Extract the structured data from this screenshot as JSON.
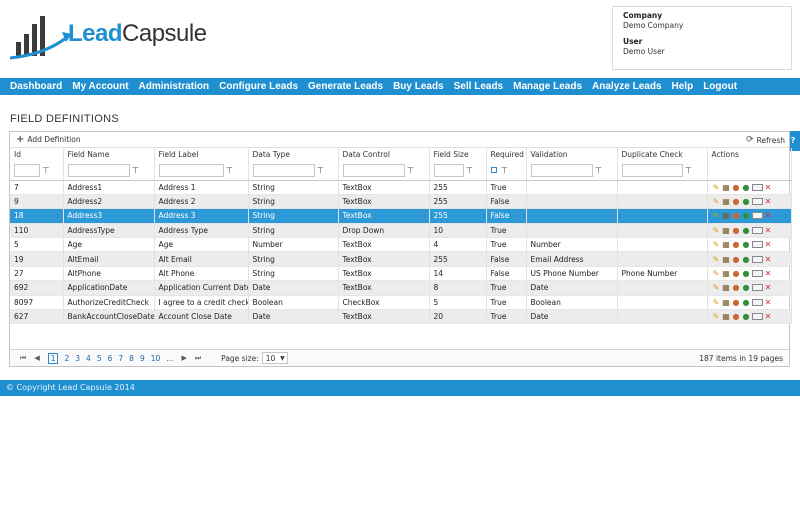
{
  "header": {
    "logo": {
      "lead": "Lead",
      "capsule": "Capsule"
    },
    "company_label": "Company",
    "company_value": "Demo Company",
    "user_label": "User",
    "user_value": "Demo User"
  },
  "nav": [
    "Dashboard",
    "My Account",
    "Administration",
    "Configure Leads",
    "Generate Leads",
    "Buy Leads",
    "Sell Leads",
    "Manage Leads",
    "Analyze Leads",
    "Help",
    "Logout"
  ],
  "page_title": "FIELD DEFINITIONS",
  "toolbar": {
    "add_label": "Add Definition",
    "refresh_label": "Refresh",
    "help": "?"
  },
  "columns": [
    "Id",
    "Field Name",
    "Field Label",
    "Data Type",
    "Data Control",
    "Field Size",
    "Required",
    "Validation",
    "Duplicate Check",
    "Actions"
  ],
  "rows": [
    {
      "id": "7",
      "name": "Address1",
      "label": "Address 1",
      "type": "String",
      "control": "TextBox",
      "size": "255",
      "required": "True",
      "validation": "",
      "dup": ""
    },
    {
      "id": "9",
      "name": "Address2",
      "label": "Address 2",
      "type": "String",
      "control": "TextBox",
      "size": "255",
      "required": "False",
      "validation": "",
      "dup": ""
    },
    {
      "id": "18",
      "name": "Address3",
      "label": "Address 3",
      "type": "String",
      "control": "TextBox",
      "size": "255",
      "required": "False",
      "validation": "",
      "dup": ""
    },
    {
      "id": "110",
      "name": "AddressType",
      "label": "Address Type",
      "type": "String",
      "control": "Drop Down",
      "size": "10",
      "required": "True",
      "validation": "",
      "dup": ""
    },
    {
      "id": "5",
      "name": "Age",
      "label": "Age",
      "type": "Number",
      "control": "TextBox",
      "size": "4",
      "required": "True",
      "validation": "Number",
      "dup": ""
    },
    {
      "id": "19",
      "name": "AltEmail",
      "label": "Alt Email",
      "type": "String",
      "control": "TextBox",
      "size": "255",
      "required": "False",
      "validation": "Email Address",
      "dup": ""
    },
    {
      "id": "27",
      "name": "AltPhone",
      "label": "Alt Phone",
      "type": "String",
      "control": "TextBox",
      "size": "14",
      "required": "False",
      "validation": "US Phone Number",
      "dup": "Phone Number"
    },
    {
      "id": "692",
      "name": "ApplicationDate",
      "label": "Application Current Date",
      "type": "Date",
      "control": "TextBox",
      "size": "8",
      "required": "True",
      "validation": "Date",
      "dup": ""
    },
    {
      "id": "8097",
      "name": "AuthorizeCreditCheck",
      "label": "I agree to a credit check",
      "type": "Boolean",
      "control": "CheckBox",
      "size": "5",
      "required": "True",
      "validation": "Boolean",
      "dup": ""
    },
    {
      "id": "627",
      "name": "BankAccountCloseDate",
      "label": "Account Close Date",
      "type": "Date",
      "control": "TextBox",
      "size": "20",
      "required": "True",
      "validation": "Date",
      "dup": ""
    }
  ],
  "pager": {
    "current": "1",
    "pages": [
      "2",
      "3",
      "4",
      "5",
      "6",
      "7",
      "8",
      "9",
      "10",
      "..."
    ],
    "page_size_label": "Page size:",
    "page_size": "10",
    "total_count": "187",
    "total_mid": "items in",
    "total_pages": "19",
    "total_suffix": "pages"
  },
  "footer": "© Copyright Lead Capsule 2014"
}
